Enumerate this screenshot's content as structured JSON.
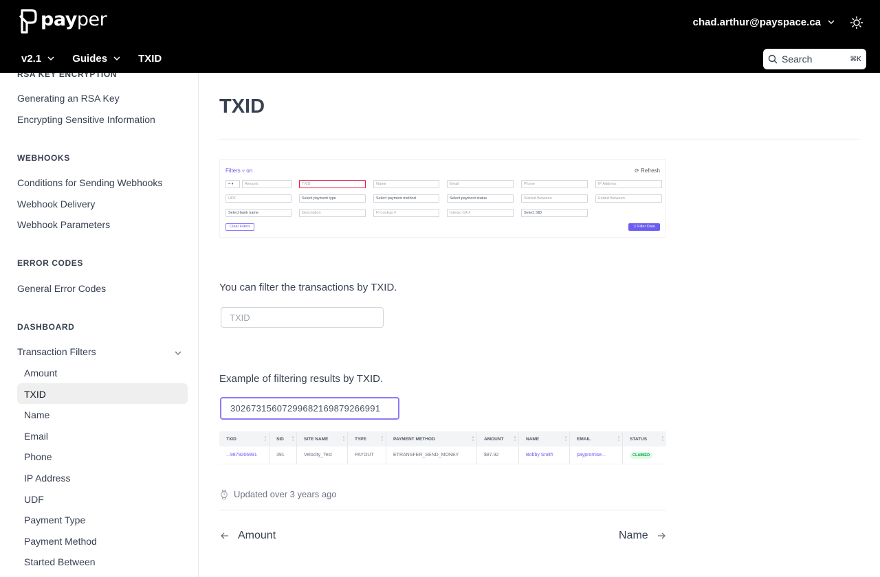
{
  "header": {
    "logo_bold": "pay",
    "logo_light": "per",
    "user_email": "chad.arthur@payspace.ca",
    "nav": [
      {
        "label": "v2.1"
      },
      {
        "label": "Guides"
      },
      {
        "label": "TXID"
      }
    ],
    "search_placeholder": "Search",
    "search_shortcut": "⌘K"
  },
  "sidebar": {
    "sections": [
      {
        "title": "RSA KEY ENCRYPTION",
        "items": [
          "Generating an RSA Key",
          "Encrypting Sensitive Information"
        ]
      },
      {
        "title": "WEBHOOKS",
        "items": [
          "Conditions for Sending Webhooks",
          "Webhook Delivery",
          "Webhook Parameters"
        ]
      },
      {
        "title": "ERROR CODES",
        "items": [
          "General Error Codes"
        ]
      },
      {
        "title": "DASHBOARD",
        "items": [
          "Transaction Filters"
        ]
      }
    ],
    "sub_items": [
      "Amount",
      "TXID",
      "Name",
      "Email",
      "Phone",
      "IP Address",
      "UDF",
      "Payment Type",
      "Payment Method",
      "Started Between"
    ],
    "active": "TXID"
  },
  "main": {
    "title": "TXID",
    "filter_shot": {
      "label": "Filters ▿ on",
      "refresh": "⟳ Refresh",
      "row1": [
        "Amount",
        "TXID",
        "Name",
        "Email",
        "Phone",
        "IP Address"
      ],
      "row2": [
        "UDF",
        "Select payment type",
        "Select payment method",
        "Select payment status",
        "Started Between",
        "Ended Between"
      ],
      "row3": [
        "Select bank name",
        "Description",
        "FI Lookup #",
        "Interac CA #",
        "Select SID"
      ],
      "clear": "Clear Filters",
      "filter": "▽ Filter Data"
    },
    "para1": "You can filter the transactions by TXID.",
    "txid_placeholder": "TXID",
    "para2": "Example of filtering results by TXID.",
    "txid_value": "302673156072996821698792669​91",
    "table": {
      "columns": [
        "TXID",
        "SID",
        "SITE NAME",
        "TYPE",
        "PAYMENT METHOD",
        "AMOUNT",
        "NAME",
        "EMAIL",
        "STATUS"
      ],
      "row": [
        "...9879266991",
        "391",
        "Velocity_Test",
        "PAYOUT",
        "ETRANSFER_SEND_MONEY",
        "$87.92",
        "Bobby Smith",
        "paypromise...",
        "CLAIMED"
      ]
    },
    "updated": "Updated over 3 years ago",
    "prev": "Amount",
    "next": "Name"
  }
}
